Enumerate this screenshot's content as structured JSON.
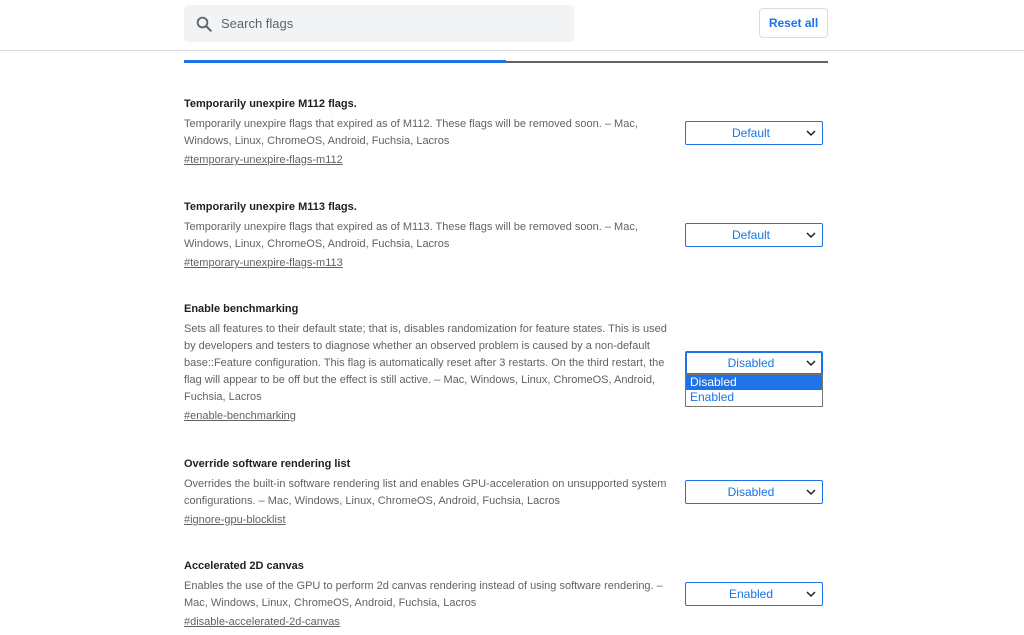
{
  "search": {
    "placeholder": "Search flags"
  },
  "toolbar": {
    "reset_label": "Reset all"
  },
  "flags": [
    {
      "title": "Temporarily unexpire M112 flags.",
      "description": "Temporarily unexpire flags that expired as of M112. These flags will be removed soon. – Mac, Windows, Linux, ChromeOS, Android, Fuchsia, Lacros",
      "link": "#temporary-unexpire-flags-m112",
      "value": "Default"
    },
    {
      "title": "Temporarily unexpire M113 flags.",
      "description": "Temporarily unexpire flags that expired as of M113. These flags will be removed soon. – Mac, Windows, Linux, ChromeOS, Android, Fuchsia, Lacros",
      "link": "#temporary-unexpire-flags-m113",
      "value": "Default"
    },
    {
      "title": "Enable benchmarking",
      "description": "Sets all features to their default state; that is, disables randomization for feature states. This is used by developers and testers to diagnose whether an observed problem is caused by a non-default base::Feature configuration. This flag is automatically reset after 3 restarts. On the third restart, the flag will appear to be off but the effect is still active. – Mac, Windows, Linux, ChromeOS, Android, Fuchsia, Lacros",
      "link": "#enable-benchmarking",
      "value": "Disabled",
      "options": [
        "Disabled",
        "Enabled"
      ]
    },
    {
      "title": "Override software rendering list",
      "description": "Overrides the built-in software rendering list and enables GPU-acceleration on unsupported system configurations. – Mac, Windows, Linux, ChromeOS, Android, Fuchsia, Lacros",
      "link": "#ignore-gpu-blocklist",
      "value": "Disabled"
    },
    {
      "title": "Accelerated 2D canvas",
      "description": "Enables the use of the GPU to perform 2d canvas rendering instead of using software rendering. – Mac, Windows, Linux, ChromeOS, Android, Fuchsia, Lacros",
      "link": "#disable-accelerated-2d-canvas",
      "value": "Enabled"
    }
  ],
  "colors": {
    "accent": "#1a73e8",
    "text": "#202124",
    "muted": "#5f6368"
  },
  "icons": {
    "search": "search-icon",
    "chevron": "chevron-down-icon"
  }
}
